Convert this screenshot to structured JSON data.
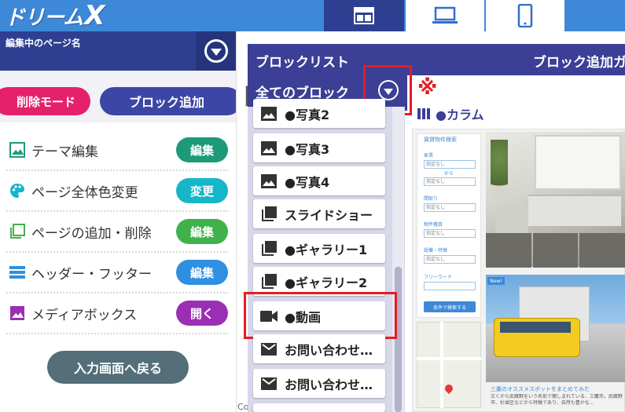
{
  "app": {
    "logo_text": "ドリーム",
    "logo_x": "X"
  },
  "device_tabs": [
    {
      "name": "layout-icon",
      "active": true
    },
    {
      "name": "laptop-icon",
      "active": false
    },
    {
      "name": "smartphone-icon",
      "active": false
    }
  ],
  "left_panel": {
    "page_name_label": "編集中のページ名",
    "delete_mode_label": "削除モード",
    "add_block_label": "ブロック追加",
    "menu": [
      {
        "label": "テーマ編集",
        "button": "編集",
        "icon": "image-icon",
        "color": "#1d9b79"
      },
      {
        "label": "ページ全体色変更",
        "button": "変更",
        "icon": "palette-icon",
        "color": "#15b6c9"
      },
      {
        "label": "ページの追加・削除",
        "button": "編集",
        "icon": "pages-icon",
        "color": "#3fb24b"
      },
      {
        "label": "ヘッダー・フッター",
        "button": "編集",
        "icon": "header-icon",
        "color": "#2f8fe0"
      },
      {
        "label": "メディアボックス",
        "button": "開く",
        "icon": "media-icon",
        "color": "#9b2fb3"
      }
    ],
    "back_label": "入力画面へ戻る"
  },
  "block_list": {
    "title": "ブロックリスト",
    "title_right": "ブロック追加ガ",
    "filter_value": "全てのブロック",
    "note_mark": "※",
    "items": [
      {
        "label": "●写真2",
        "icon": "photo-icon"
      },
      {
        "label": "●写真3",
        "icon": "photo-icon"
      },
      {
        "label": "●写真4",
        "icon": "photo-icon"
      },
      {
        "label": "スライドショー",
        "icon": "slideshow-icon"
      },
      {
        "label": "●ギャラリー1",
        "icon": "gallery-icon"
      },
      {
        "label": "●ギャラリー2",
        "icon": "gallery-icon"
      },
      {
        "label": "●動画",
        "icon": "video-icon"
      },
      {
        "label": "お問い合わせ…",
        "icon": "mail-icon"
      },
      {
        "label": "お問い合わせ…",
        "icon": "mail-icon"
      }
    ]
  },
  "background": {
    "peek_letter": "ト",
    "peek_co": "Co"
  },
  "preview": {
    "column_label": "●カラム",
    "form_title": "賃貸物件検索",
    "fields": [
      {
        "label": "家賃",
        "value": "指定なし"
      },
      {
        "label": "",
        "value": "指定なし"
      },
      {
        "label": "間取り",
        "value": "指定なし"
      },
      {
        "label": "物件種目",
        "value": "指定なし"
      },
      {
        "label": "設備・特徴",
        "value": "指定なし"
      },
      {
        "label": "フリーワード",
        "value": ""
      }
    ],
    "range_sep": "から",
    "search_button": "条件で検索する",
    "new_badge": "New!",
    "caption": "三鷹のオススメスポットをまとめてみた",
    "caption_text": "古くから武蔵野をいう名前で親しまれている、三鷹市。武蔵野市、杉並区などから特徴であり、自然も豊かな..."
  }
}
